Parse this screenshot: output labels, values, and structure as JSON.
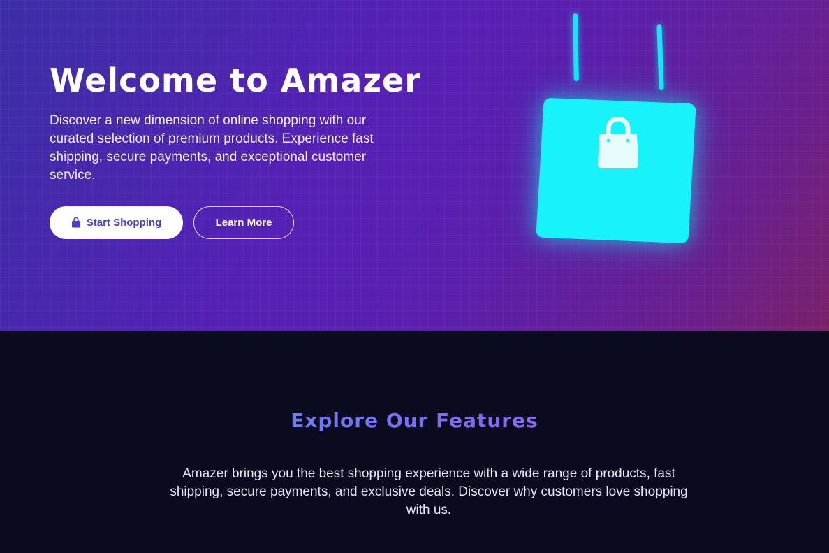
{
  "hero": {
    "title": "Welcome to Amazer",
    "description": "Discover a new dimension of online shopping with our curated selection of premium products. Experience fast shipping, secure payments, and exceptional customer service.",
    "primary_button": {
      "label": "Start Shopping",
      "icon": "shopping-bag-icon"
    },
    "secondary_button": {
      "label": "Learn More"
    },
    "illustration_icon": "shopping-bag-icon"
  },
  "features": {
    "title": "Explore Our Features",
    "description": "Amazer brings you the best shopping experience with a wide range of products, fast shipping, secure payments, and exclusive deals. Discover why customers love shopping with us."
  },
  "colors": {
    "accent_cyan": "#18f2fb",
    "hero_gradient_start": "#3b2fa6",
    "hero_gradient_end": "#7a2168",
    "dark_background": "#0a0b1f",
    "primary_button_text": "#4b3fc9"
  }
}
